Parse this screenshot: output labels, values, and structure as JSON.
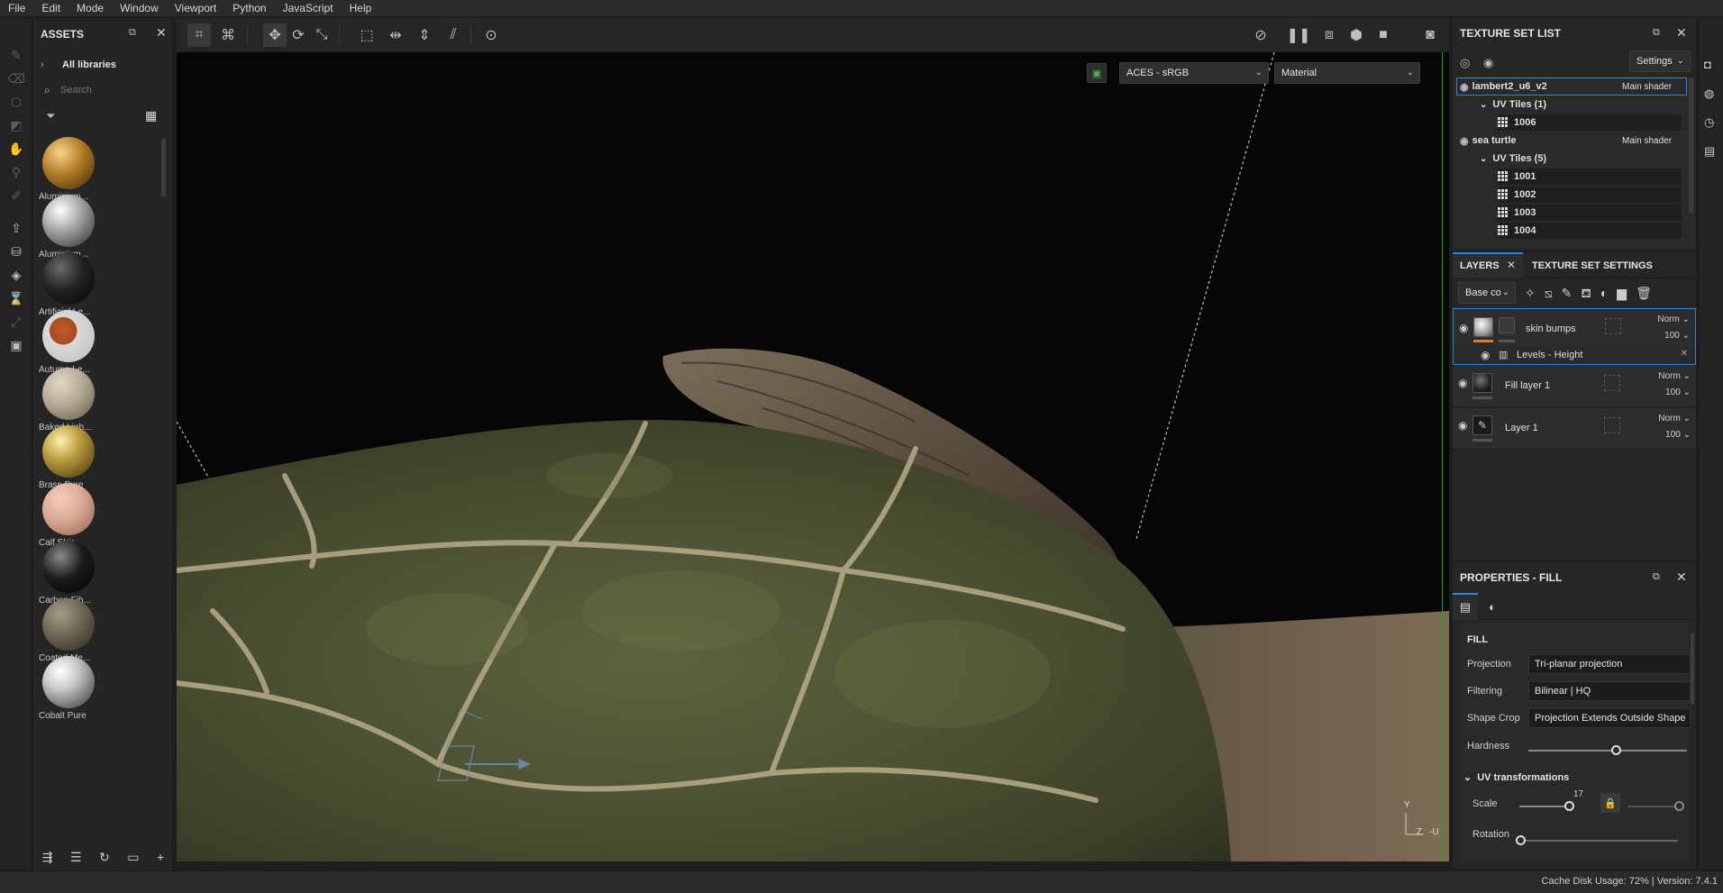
{
  "menu": [
    "File",
    "Edit",
    "Mode",
    "Window",
    "Viewport",
    "Python",
    "JavaScript",
    "Help"
  ],
  "assets": {
    "title": "ASSETS",
    "library": "All libraries",
    "search_placeholder": "Search",
    "items": [
      {
        "label": "Aluminium...",
        "color": "#b07a25"
      },
      {
        "label": "Aluminium...",
        "color": "#c8c8c8"
      },
      {
        "label": "Artificial Le...",
        "color": "#222222"
      },
      {
        "label": "Autumn Le...",
        "color": "#a84a22"
      },
      {
        "label": "Baked Ligh...",
        "color": "#b5a995"
      },
      {
        "label": "Brass Pure",
        "color": "#b89a3c"
      },
      {
        "label": "Calf Skin",
        "color": "#d9a892"
      },
      {
        "label": "Carbon Fib...",
        "color": "#1c1c1c"
      },
      {
        "label": "Coated Me...",
        "color": "#6d6553"
      },
      {
        "label": "Cobalt Pure",
        "color": "#c9c9c9"
      }
    ]
  },
  "viewport": {
    "colorspace": "ACES - sRGB",
    "display_mode": "Material",
    "gizmo_y": "Y",
    "gizmo_z": "Z",
    "gizmo_u": "-U"
  },
  "texture_set_list": {
    "title": "TEXTURE SET LIST",
    "settings_label": "Settings",
    "sets": [
      {
        "name": "lambert2_u6_v2",
        "shader": "Main shader",
        "uv_label": "UV Tiles (1)",
        "tiles": [
          "1006"
        ]
      },
      {
        "name": "sea turtle",
        "shader": "Main shader",
        "uv_label": "UV Tiles (5)",
        "tiles": [
          "1001",
          "1002",
          "1003",
          "1004"
        ]
      }
    ]
  },
  "layers_panel": {
    "tab_layers": "LAYERS",
    "tab_settings": "TEXTURE SET SETTINGS",
    "channel": "Base co",
    "layers": [
      {
        "name": "skin bumps",
        "blend": "Norm",
        "opacity": "100",
        "effect": "Levels - Height"
      },
      {
        "name": "Fill layer 1",
        "blend": "Norm",
        "opacity": "100"
      },
      {
        "name": "Layer 1",
        "blend": "Norm",
        "opacity": "100"
      }
    ]
  },
  "properties": {
    "title": "PROPERTIES - FILL",
    "section": "FILL",
    "projection_label": "Projection",
    "projection_value": "Tri-planar projection",
    "filtering_label": "Filtering",
    "filtering_value": "Bilinear | HQ",
    "shape_crop_label": "Shape Crop",
    "shape_crop_value": "Projection Extends Outside Shape",
    "hardness_label": "Hardness",
    "uv_section": "UV transformations",
    "scale_label": "Scale",
    "scale_value": "17",
    "rotation_label": "Rotation"
  },
  "status": {
    "text": "Cache Disk Usage:   72% | Version: 7.4.1"
  },
  "colors": {
    "accent": "#2a86e0",
    "orange": "#e07a22"
  }
}
